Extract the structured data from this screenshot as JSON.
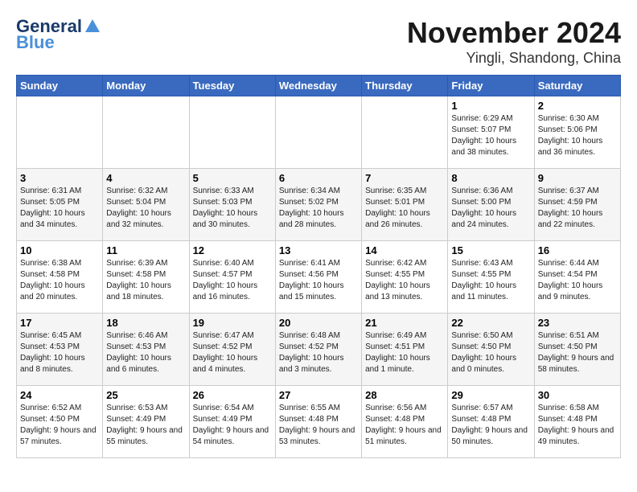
{
  "logo": {
    "name_part1": "General",
    "name_part2": "Blue",
    "tagline": ""
  },
  "title": "November 2024",
  "subtitle": "Yingli, Shandong, China",
  "weekdays": [
    "Sunday",
    "Monday",
    "Tuesday",
    "Wednesday",
    "Thursday",
    "Friday",
    "Saturday"
  ],
  "weeks": [
    [
      {
        "day": "",
        "info": ""
      },
      {
        "day": "",
        "info": ""
      },
      {
        "day": "",
        "info": ""
      },
      {
        "day": "",
        "info": ""
      },
      {
        "day": "",
        "info": ""
      },
      {
        "day": "1",
        "info": "Sunrise: 6:29 AM\nSunset: 5:07 PM\nDaylight: 10 hours and 38 minutes."
      },
      {
        "day": "2",
        "info": "Sunrise: 6:30 AM\nSunset: 5:06 PM\nDaylight: 10 hours and 36 minutes."
      }
    ],
    [
      {
        "day": "3",
        "info": "Sunrise: 6:31 AM\nSunset: 5:05 PM\nDaylight: 10 hours and 34 minutes."
      },
      {
        "day": "4",
        "info": "Sunrise: 6:32 AM\nSunset: 5:04 PM\nDaylight: 10 hours and 32 minutes."
      },
      {
        "day": "5",
        "info": "Sunrise: 6:33 AM\nSunset: 5:03 PM\nDaylight: 10 hours and 30 minutes."
      },
      {
        "day": "6",
        "info": "Sunrise: 6:34 AM\nSunset: 5:02 PM\nDaylight: 10 hours and 28 minutes."
      },
      {
        "day": "7",
        "info": "Sunrise: 6:35 AM\nSunset: 5:01 PM\nDaylight: 10 hours and 26 minutes."
      },
      {
        "day": "8",
        "info": "Sunrise: 6:36 AM\nSunset: 5:00 PM\nDaylight: 10 hours and 24 minutes."
      },
      {
        "day": "9",
        "info": "Sunrise: 6:37 AM\nSunset: 4:59 PM\nDaylight: 10 hours and 22 minutes."
      }
    ],
    [
      {
        "day": "10",
        "info": "Sunrise: 6:38 AM\nSunset: 4:58 PM\nDaylight: 10 hours and 20 minutes."
      },
      {
        "day": "11",
        "info": "Sunrise: 6:39 AM\nSunset: 4:58 PM\nDaylight: 10 hours and 18 minutes."
      },
      {
        "day": "12",
        "info": "Sunrise: 6:40 AM\nSunset: 4:57 PM\nDaylight: 10 hours and 16 minutes."
      },
      {
        "day": "13",
        "info": "Sunrise: 6:41 AM\nSunset: 4:56 PM\nDaylight: 10 hours and 15 minutes."
      },
      {
        "day": "14",
        "info": "Sunrise: 6:42 AM\nSunset: 4:55 PM\nDaylight: 10 hours and 13 minutes."
      },
      {
        "day": "15",
        "info": "Sunrise: 6:43 AM\nSunset: 4:55 PM\nDaylight: 10 hours and 11 minutes."
      },
      {
        "day": "16",
        "info": "Sunrise: 6:44 AM\nSunset: 4:54 PM\nDaylight: 10 hours and 9 minutes."
      }
    ],
    [
      {
        "day": "17",
        "info": "Sunrise: 6:45 AM\nSunset: 4:53 PM\nDaylight: 10 hours and 8 minutes."
      },
      {
        "day": "18",
        "info": "Sunrise: 6:46 AM\nSunset: 4:53 PM\nDaylight: 10 hours and 6 minutes."
      },
      {
        "day": "19",
        "info": "Sunrise: 6:47 AM\nSunset: 4:52 PM\nDaylight: 10 hours and 4 minutes."
      },
      {
        "day": "20",
        "info": "Sunrise: 6:48 AM\nSunset: 4:52 PM\nDaylight: 10 hours and 3 minutes."
      },
      {
        "day": "21",
        "info": "Sunrise: 6:49 AM\nSunset: 4:51 PM\nDaylight: 10 hours and 1 minute."
      },
      {
        "day": "22",
        "info": "Sunrise: 6:50 AM\nSunset: 4:50 PM\nDaylight: 10 hours and 0 minutes."
      },
      {
        "day": "23",
        "info": "Sunrise: 6:51 AM\nSunset: 4:50 PM\nDaylight: 9 hours and 58 minutes."
      }
    ],
    [
      {
        "day": "24",
        "info": "Sunrise: 6:52 AM\nSunset: 4:50 PM\nDaylight: 9 hours and 57 minutes."
      },
      {
        "day": "25",
        "info": "Sunrise: 6:53 AM\nSunset: 4:49 PM\nDaylight: 9 hours and 55 minutes."
      },
      {
        "day": "26",
        "info": "Sunrise: 6:54 AM\nSunset: 4:49 PM\nDaylight: 9 hours and 54 minutes."
      },
      {
        "day": "27",
        "info": "Sunrise: 6:55 AM\nSunset: 4:48 PM\nDaylight: 9 hours and 53 minutes."
      },
      {
        "day": "28",
        "info": "Sunrise: 6:56 AM\nSunset: 4:48 PM\nDaylight: 9 hours and 51 minutes."
      },
      {
        "day": "29",
        "info": "Sunrise: 6:57 AM\nSunset: 4:48 PM\nDaylight: 9 hours and 50 minutes."
      },
      {
        "day": "30",
        "info": "Sunrise: 6:58 AM\nSunset: 4:48 PM\nDaylight: 9 hours and 49 minutes."
      }
    ]
  ]
}
